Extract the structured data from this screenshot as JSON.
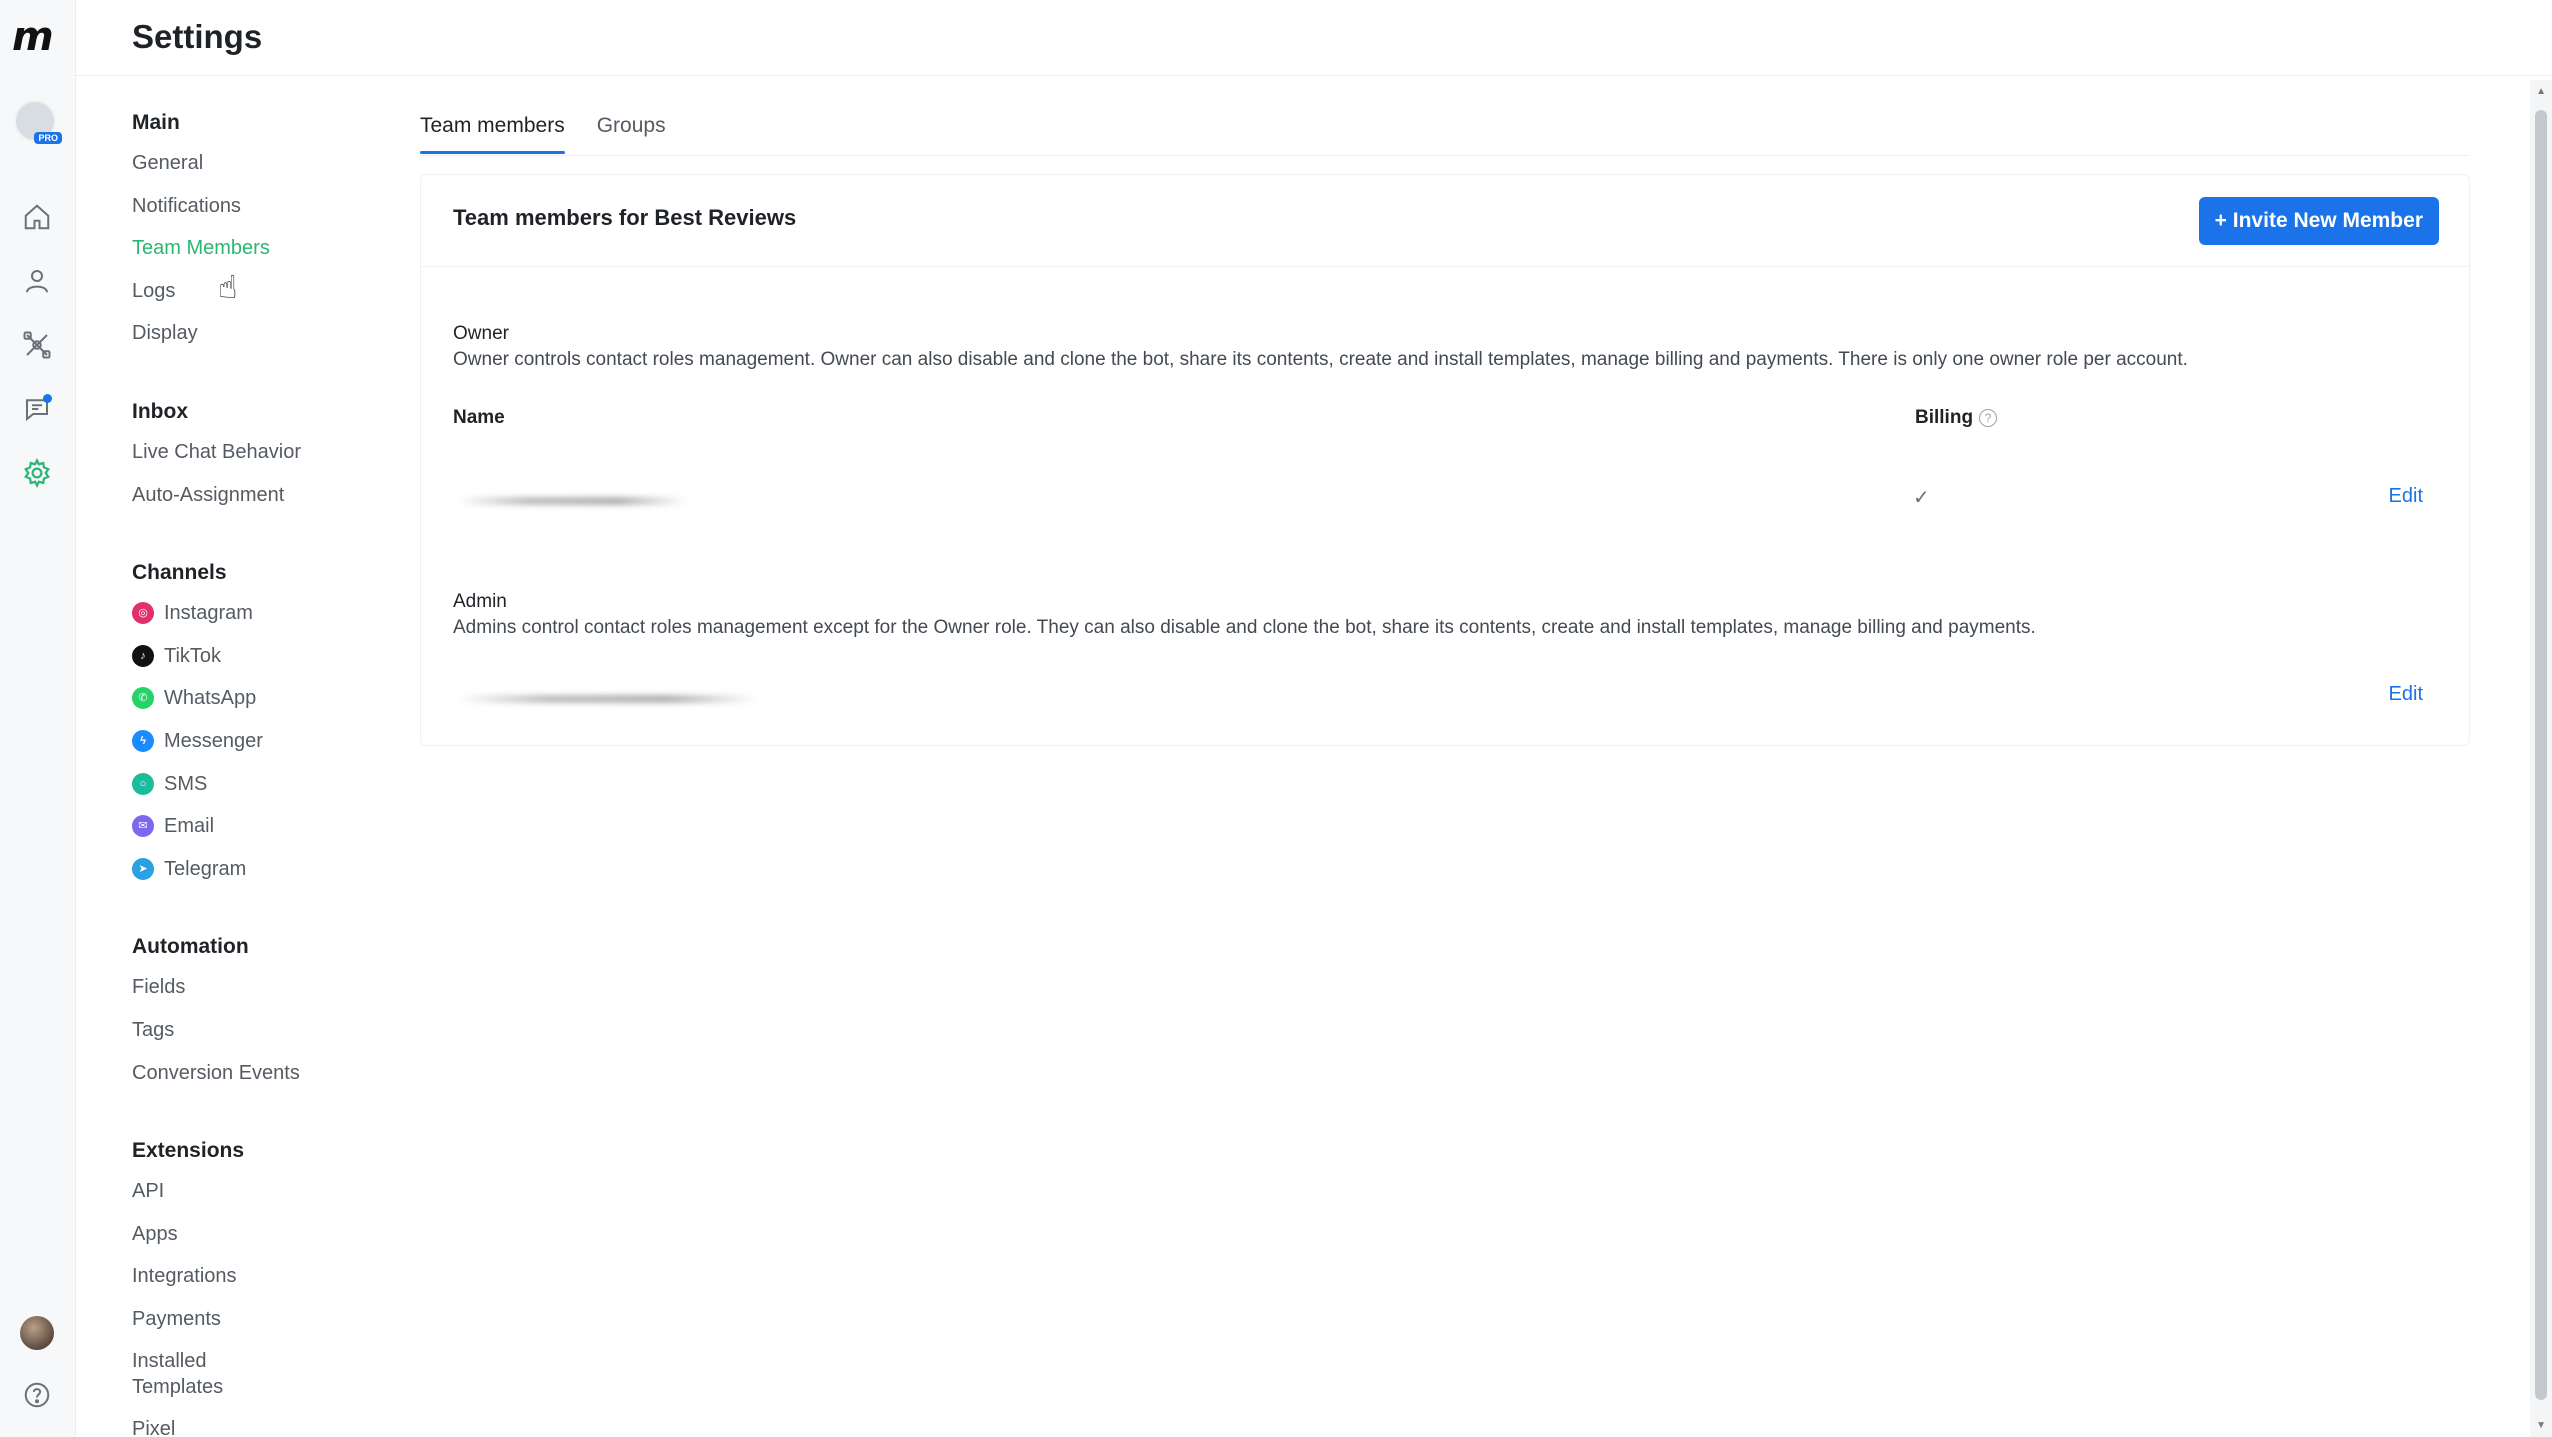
{
  "header": {
    "title": "Settings"
  },
  "rail": {
    "pro_badge": "PRO",
    "icons": [
      "home-icon",
      "contacts-icon",
      "automation-icon",
      "chat-icon",
      "settings-icon"
    ],
    "bottom_icons": [
      "user-avatar",
      "help-icon"
    ]
  },
  "nav": {
    "main": {
      "heading": "Main",
      "items": [
        "General",
        "Notifications",
        "Team Members",
        "Logs",
        "Display"
      ]
    },
    "inbox": {
      "heading": "Inbox",
      "items": [
        "Live Chat Behavior",
        "Auto-Assignment"
      ]
    },
    "channels": {
      "heading": "Channels",
      "items": [
        "Instagram",
        "TikTok",
        "WhatsApp",
        "Messenger",
        "SMS",
        "Email",
        "Telegram"
      ]
    },
    "automation": {
      "heading": "Automation",
      "items": [
        "Fields",
        "Tags",
        "Conversion Events"
      ]
    },
    "extensions": {
      "heading": "Extensions",
      "items": [
        "API",
        "Apps",
        "Integrations",
        "Payments",
        "Installed Templates",
        "Pixel"
      ]
    }
  },
  "colors": {
    "accent": "#1a73e8",
    "active_nav": "#2bb673",
    "instagram": "#e1306c",
    "tiktok": "#111111",
    "whatsapp": "#25d366",
    "messenger": "#1a8cff",
    "sms": "#1abc9c",
    "email": "#7b68ee",
    "telegram": "#2aa1e0"
  },
  "tabs": [
    "Team members",
    "Groups"
  ],
  "card": {
    "title": "Team members for Best Reviews",
    "invite_button": "+ Invite New Member",
    "owner": {
      "title": "Owner",
      "description": "Owner controls contact roles management. Owner can also disable and clone the bot, share its contents, create and install templates, manage billing and payments. There is only one owner role per account.",
      "col_name": "Name",
      "col_billing": "Billing",
      "check": "✓",
      "edit": "Edit"
    },
    "admin": {
      "title": "Admin",
      "description": "Admins control contact roles management except for the Owner role. They can also disable and clone the bot, share its contents, create and install templates, manage billing and payments.",
      "edit": "Edit"
    }
  }
}
